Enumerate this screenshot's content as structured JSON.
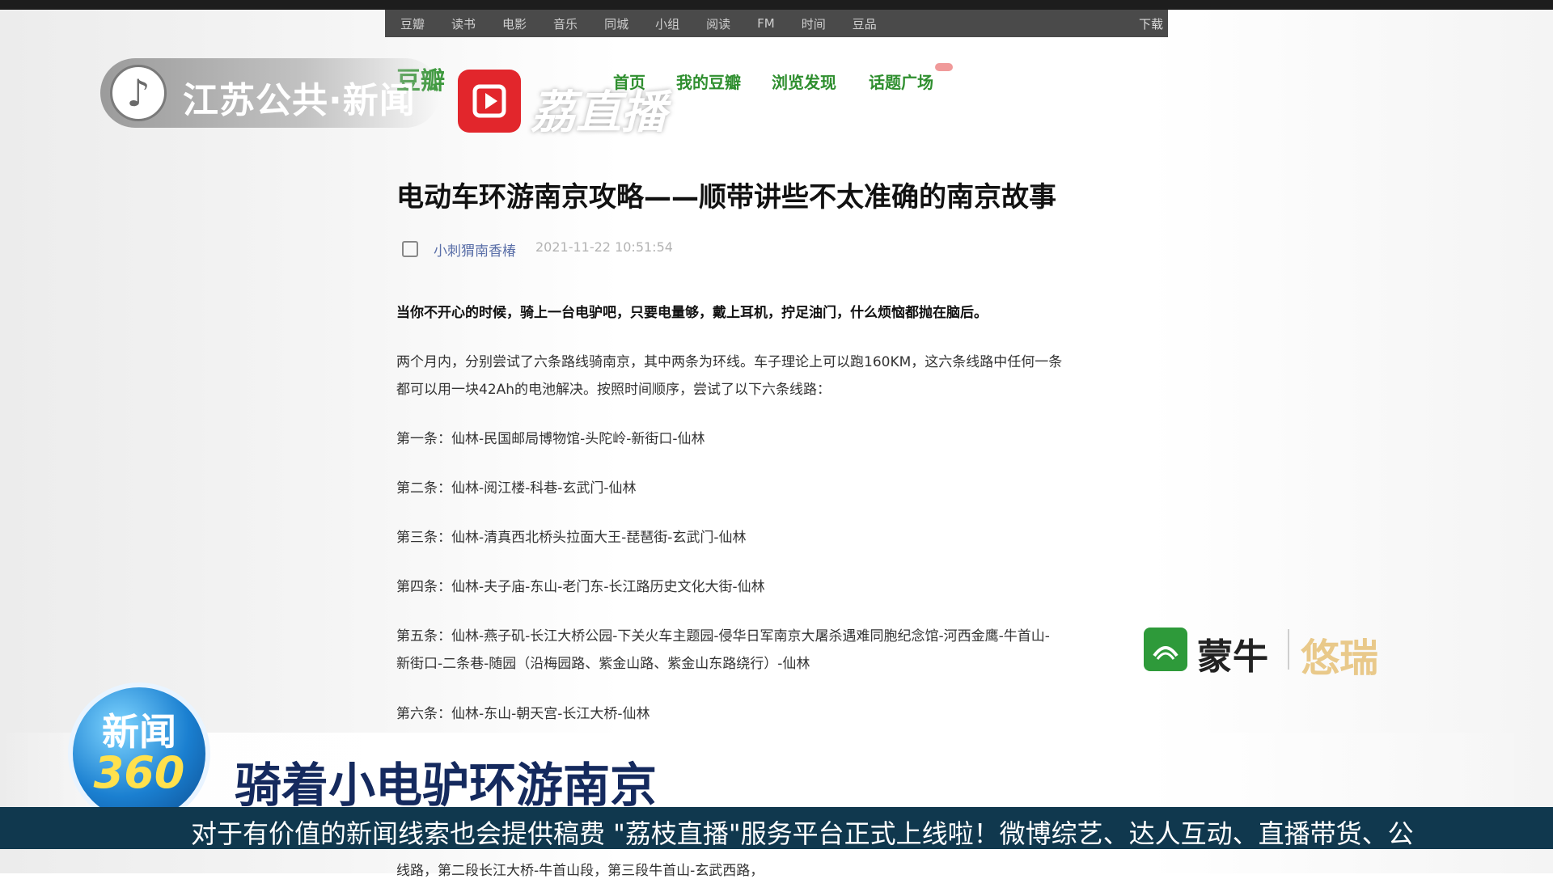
{
  "site": {
    "nav": [
      "豆瓣",
      "读书",
      "电影",
      "音乐",
      "同城",
      "小组",
      "阅读",
      "FM",
      "时间",
      "豆品"
    ],
    "download": "下载",
    "logo": "豆瓣",
    "menu": [
      "首页",
      "我的豆瓣",
      "浏览发现",
      "话题广场"
    ]
  },
  "article": {
    "title": "电动车环游南京攻略——顺带讲些不太准确的南京故事",
    "author": "小刺猬南香椿",
    "time": "2021-11-22 10:51:54",
    "intro": "当你不开心的时候，骑上一台电驴吧，只要电量够，戴上耳机，拧足油门，什么烦恼都抛在脑后。",
    "para1_line1": "两个月内，分别尝试了六条路线骑南京，其中两条为环线。车子理论上可以跑160KM，这六条线路中任何一条",
    "para1_line2": "都可以用一块42Ah的电池解决。按照时间顺序，尝试了以下六条线路：",
    "route1": "第一条：仙林-民国邮局博物馆-头陀岭-新街口-仙林",
    "route2": "第二条：仙林-阅江楼-科巷-玄武门-仙林",
    "route3": "第三条：仙林-清真西北桥头拉面大王-琵琶街-玄武门-仙林",
    "route4": "第四条：仙林-夫子庙-东山-老门东-长江路历史文化大街-仙林",
    "route5_line1": "第五条：仙林-燕子矶-长江大桥公园-下关火车主题园-侵华日军南京大屠杀遇难同胞纪念馆-河西金鹰-牛首山-",
    "route5_line2": "新街口-二条巷-随园（沿梅园路、紫金山路、紫金山东路绕行）-仙林",
    "route6": "第六条：仙林-东山-朝天宫-长江大桥-仙林",
    "below": "线路，第二段长江大桥-牛首山段，第三段牛首山-玄武西路，"
  },
  "overlay": {
    "channel": "江苏公共·新闻",
    "live_app": "荔直播",
    "sponsor": "蒙牛",
    "sponsor_sub": "悠瑞",
    "program_line1": "新闻",
    "program_line2": "360",
    "headline": "骑着小电驴环游南京",
    "ticker": "对于有价值的新闻线索也会提供稿费    \"荔枝直播\"服务平台正式上线啦！微博综艺、达人互动、直播带货、公"
  },
  "colors": {
    "ticker_bg": "#10384e",
    "headline": "#152a5e",
    "site_green": "#3f9a3f",
    "live_red": "#e2262c"
  }
}
